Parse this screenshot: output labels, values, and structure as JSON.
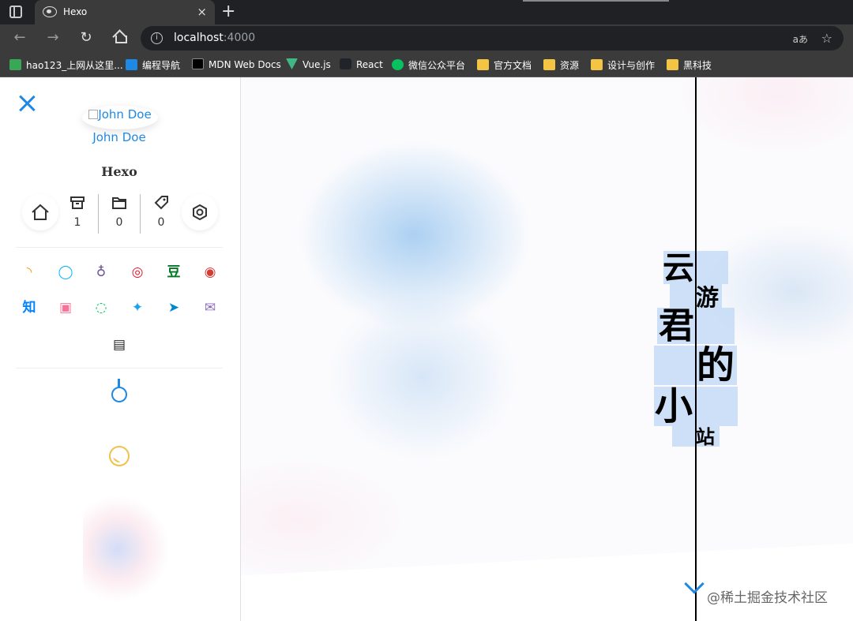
{
  "browser": {
    "tab_title": "Hexo",
    "tab_close": "×",
    "new_tab": "+",
    "url_host": "localhost",
    "url_port": ":4000",
    "read_aloud": "aあ",
    "nav": {
      "back": "←",
      "forward": "→",
      "reload": "↻"
    },
    "bookmarks": [
      {
        "label": "hao123_上网从这里...",
        "icon_color": "#3aa757"
      },
      {
        "label": "编程导航",
        "icon_color": "#1e88e5"
      },
      {
        "label": "MDN Web Docs",
        "icon_color": "#000000"
      },
      {
        "label": "Vue.js",
        "icon_color": "#41b883"
      },
      {
        "label": "React",
        "icon_color": "#20232a"
      },
      {
        "label": "微信公众平台",
        "icon_color": "#07c160"
      },
      {
        "label": "官方文档",
        "icon_color": "#f4c542"
      },
      {
        "label": "资源",
        "icon_color": "#f4c542"
      },
      {
        "label": "设计与创作",
        "icon_color": "#f4c542"
      },
      {
        "label": "黑科技",
        "icon_color": "#f4c542"
      }
    ]
  },
  "sidebar": {
    "avatar_alt": "John Doe",
    "author": "John Doe",
    "site_title": "Hexo",
    "stats": {
      "archives": "1",
      "categories": "0",
      "tags": "0"
    },
    "social_row1": [
      {
        "icon": "rss-icon",
        "glyph": "◝",
        "color": "#f39c12"
      },
      {
        "icon": "qq-icon",
        "glyph": "◯",
        "color": "#12b7f5"
      },
      {
        "icon": "github-icon",
        "glyph": "♁",
        "color": "#6e5494"
      },
      {
        "icon": "weibo-icon",
        "glyph": "◎",
        "color": "#e6162d"
      },
      {
        "icon": "douban-icon",
        "glyph": "豆",
        "color": "#007722"
      },
      {
        "icon": "netease-music-icon",
        "glyph": "◉",
        "color": "#d43c33"
      }
    ],
    "social_row2": [
      {
        "icon": "zhihu-icon",
        "glyph": "知",
        "color": "#0084ff"
      },
      {
        "icon": "bilibili-icon",
        "glyph": "▣",
        "color": "#fb7299"
      },
      {
        "icon": "wechat-icon",
        "glyph": "◌",
        "color": "#07c160"
      },
      {
        "icon": "twitter-icon",
        "glyph": "✦",
        "color": "#1da1f2"
      },
      {
        "icon": "telegram-icon",
        "glyph": "➤",
        "color": "#0088cc"
      },
      {
        "icon": "email-icon",
        "glyph": "✉",
        "color": "#8e6bbf"
      }
    ],
    "social_row3": [
      {
        "icon": "subway-icon",
        "glyph": "▤",
        "color": "#222222"
      }
    ]
  },
  "hero": {
    "chars": [
      "云",
      "游",
      "君",
      "的",
      "小",
      "站"
    ]
  },
  "watermark": "@稀土掘金技术社区"
}
